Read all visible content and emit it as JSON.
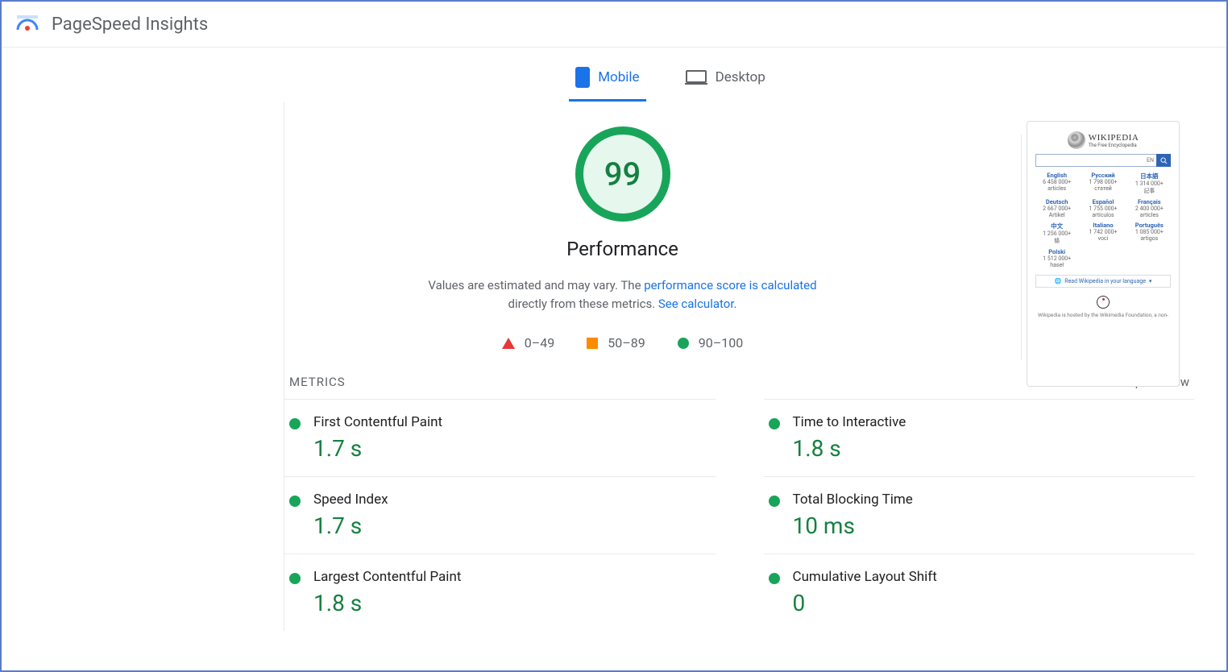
{
  "header": {
    "title": "PageSpeed Insights"
  },
  "tabs": {
    "mobile": "Mobile",
    "desktop": "Desktop"
  },
  "performance": {
    "score": "99",
    "title": "Performance",
    "desc_prefix": "Values are estimated and may vary. The ",
    "desc_link1": "performance score is calculated",
    "desc_mid": " directly from these metrics. ",
    "desc_link2": "See calculator.",
    "legend": {
      "bad": "0–49",
      "mid": "50–89",
      "good": "90–100"
    }
  },
  "metrics_section": {
    "title": "METRICS",
    "expand": "Expand view",
    "items": [
      {
        "name": "First Contentful Paint",
        "value": "1.7 s"
      },
      {
        "name": "Time to Interactive",
        "value": "1.8 s"
      },
      {
        "name": "Speed Index",
        "value": "1.7 s"
      },
      {
        "name": "Total Blocking Time",
        "value": "10 ms"
      },
      {
        "name": "Largest Contentful Paint",
        "value": "1.8 s"
      },
      {
        "name": "Cumulative Layout Shift",
        "value": "0"
      }
    ]
  },
  "preview": {
    "wordmark": "WIKIPEDIA",
    "subtitle": "The Free Encyclopedia",
    "lang_selector": "EN",
    "langs": [
      {
        "name": "English",
        "count": "6 458 000+",
        "unit": "articles"
      },
      {
        "name": "Русский",
        "count": "1 798 000+",
        "unit": "статей"
      },
      {
        "name": "日本語",
        "count": "1 314 000+",
        "unit": "記事"
      },
      {
        "name": "Deutsch",
        "count": "2 667 000+",
        "unit": "Artikel"
      },
      {
        "name": "Español",
        "count": "1 755 000+",
        "unit": "artículos"
      },
      {
        "name": "Français",
        "count": "2 400 000+",
        "unit": "articles"
      },
      {
        "name": "中文",
        "count": "1 256 000+",
        "unit": "條"
      },
      {
        "name": "Italiano",
        "count": "1 742 000+",
        "unit": "voci"
      },
      {
        "name": "Português",
        "count": "1 085 000+",
        "unit": "artigos"
      },
      {
        "name": "Polski",
        "count": "1 512 000+",
        "unit": "haseł"
      },
      {
        "name": "",
        "count": "",
        "unit": ""
      },
      {
        "name": "",
        "count": "",
        "unit": ""
      }
    ],
    "read_btn": "Read Wikipedia in your language",
    "footer": "Wikipedia is hosted by the Wikimedia Foundation, a non-"
  }
}
